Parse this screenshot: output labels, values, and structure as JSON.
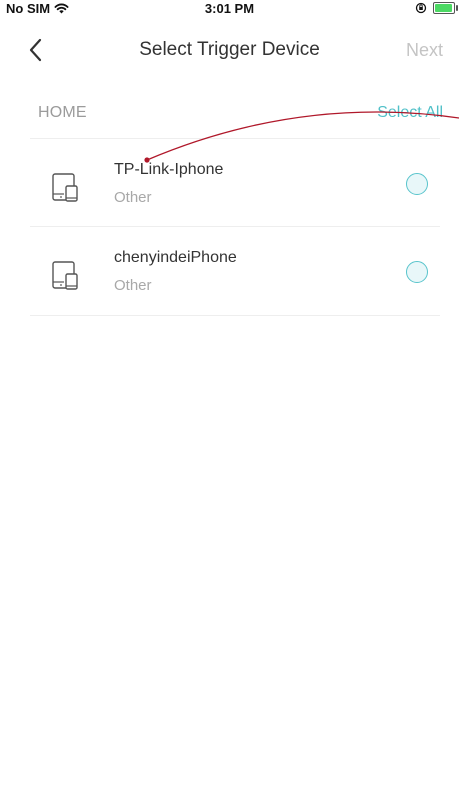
{
  "status_bar": {
    "carrier": "No SIM",
    "time": "3:01 PM"
  },
  "nav": {
    "title": "Select Trigger Device",
    "next_label": "Next"
  },
  "section": {
    "label": "HOME",
    "select_all_label": "Select All"
  },
  "devices": [
    {
      "name": "TP-Link-Iphone",
      "type": "Other",
      "selected": false
    },
    {
      "name": "chenyindeiPhone",
      "type": "Other",
      "selected": false
    }
  ],
  "colors": {
    "accent": "#50c0c8",
    "annotation": "#b0182a",
    "disabled_text": "#c4c4c4"
  }
}
